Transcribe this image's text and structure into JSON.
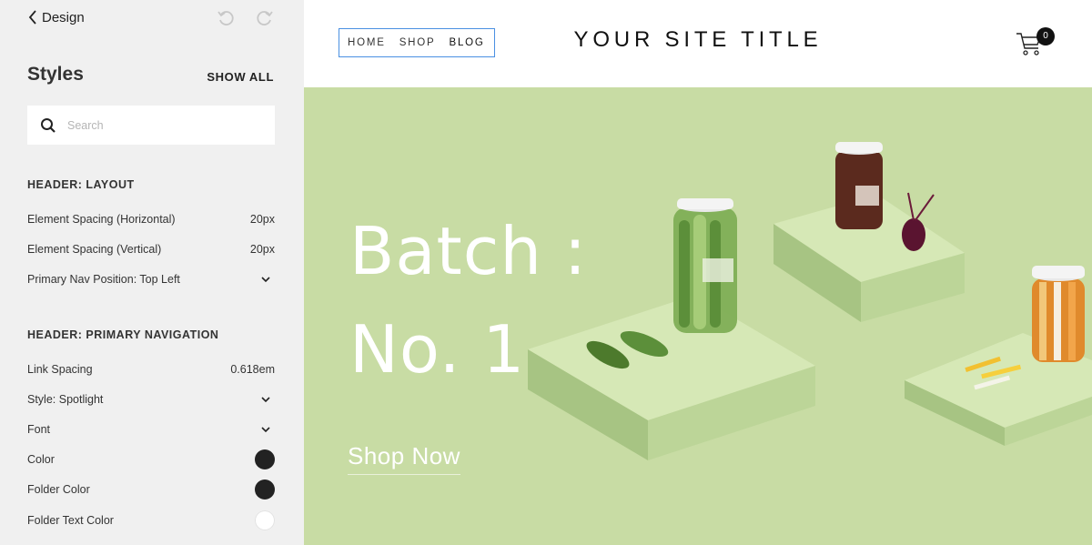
{
  "panel": {
    "back_label": "Design",
    "title": "Styles",
    "show_all": "SHOW ALL",
    "search_placeholder": "Search",
    "layout_section": {
      "title": "HEADER: LAYOUT",
      "rows": [
        {
          "label": "Element Spacing (Horizontal)",
          "value": "20px"
        },
        {
          "label": "Element Spacing (Vertical)",
          "value": "20px"
        },
        {
          "label": "Primary Nav Position: Top Left",
          "value": ""
        }
      ]
    },
    "nav_section": {
      "title": "HEADER: PRIMARY NAVIGATION",
      "rows": [
        {
          "label": "Link Spacing",
          "value": "0.618em"
        },
        {
          "label": "Style: Spotlight",
          "value": ""
        },
        {
          "label": "Font",
          "value": ""
        },
        {
          "label": "Color",
          "color": "#222222"
        },
        {
          "label": "Folder Color",
          "color": "#222222"
        },
        {
          "label": "Folder Text Color",
          "color": "#ffffff"
        }
      ]
    }
  },
  "site": {
    "nav": [
      "HOME",
      "SHOP",
      "BLOG"
    ],
    "title": "YOUR SITE TITLE",
    "cart_count": "0",
    "hero": {
      "line1": "Batch :",
      "line2": "No. 1",
      "cta": "Shop Now",
      "background": "#c8dca4"
    }
  }
}
